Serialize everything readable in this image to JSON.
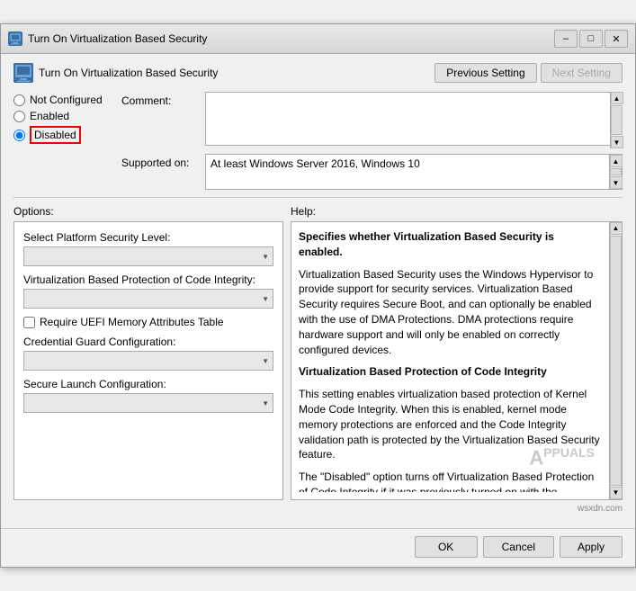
{
  "window": {
    "title": "Turn On Virtualization Based Security",
    "header_title": "Turn On Virtualization Based Security",
    "icon_label": "GP"
  },
  "header": {
    "prev_btn": "Previous Setting",
    "next_btn": "Next Setting"
  },
  "radio": {
    "not_configured": "Not Configured",
    "enabled": "Enabled",
    "disabled": "Disabled",
    "selected": "disabled"
  },
  "comment": {
    "label": "Comment:",
    "value": ""
  },
  "supported_on": {
    "label": "Supported on:",
    "value": "At least Windows Server 2016, Windows 10"
  },
  "sections": {
    "options_label": "Options:",
    "help_label": "Help:"
  },
  "options": {
    "platform_security_label": "Select Platform Security Level:",
    "platform_security_value": "",
    "code_integrity_label": "Virtualization Based Protection of Code Integrity:",
    "code_integrity_value": "",
    "uefi_checkbox": "Require UEFI Memory Attributes Table",
    "uefi_checked": false,
    "credential_guard_label": "Credential Guard Configuration:",
    "credential_guard_value": "",
    "secure_launch_label": "Secure Launch Configuration:",
    "secure_launch_value": ""
  },
  "help": {
    "paragraphs": [
      "Specifies whether Virtualization Based Security is enabled.",
      "Virtualization Based Security uses the Windows Hypervisor to provide support for security services. Virtualization Based Security requires Secure Boot, and can optionally be enabled with the use of DMA Protections. DMA protections require hardware support and will only be enabled on correctly configured devices.",
      "Virtualization Based Protection of Code Integrity",
      "This setting enables virtualization based protection of Kernel Mode Code Integrity. When this is enabled, kernel mode memory protections are enforced and the Code Integrity validation path is protected by the Virtualization Based Security feature.",
      "The \"Disabled\" option turns off Virtualization Based Protection of Code Integrity if it was previously turned on with the \"Enabled without lock\" option."
    ],
    "bold_indices": [
      2
    ]
  },
  "footer": {
    "ok_label": "OK",
    "cancel_label": "Cancel",
    "apply_label": "Apply"
  },
  "watermark": "wsxdn.com"
}
